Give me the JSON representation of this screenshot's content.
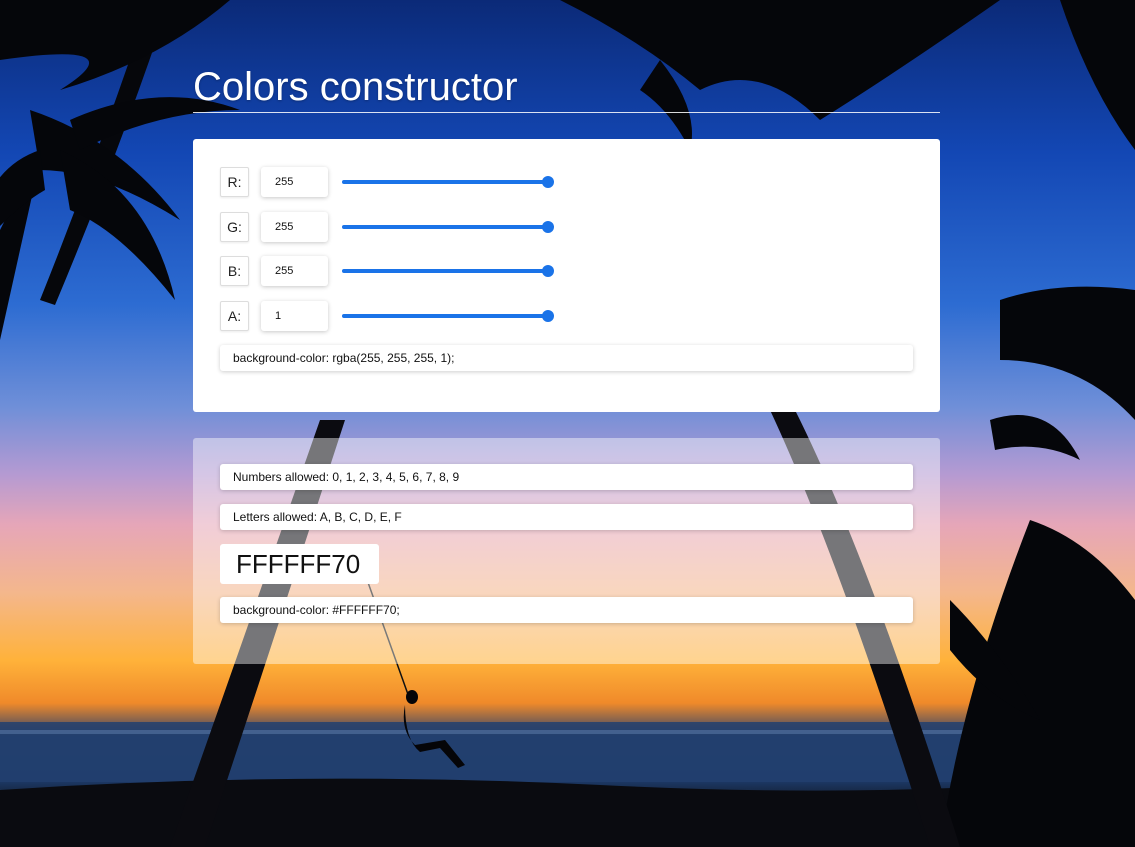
{
  "title": "Colors constructor",
  "rgba_panel": {
    "channels": [
      {
        "label": "R:",
        "value": "255",
        "fraction": 1.0
      },
      {
        "label": "G:",
        "value": "255",
        "fraction": 1.0
      },
      {
        "label": "B:",
        "value": "255",
        "fraction": 1.0
      },
      {
        "label": "A:",
        "value": "1",
        "fraction": 1.0
      }
    ],
    "output": "background-color: rgba(255, 255, 255, 1);"
  },
  "hex_panel": {
    "numbers_hint": "Numbers allowed: 0, 1, 2, 3, 4, 5, 6, 7, 8, 9",
    "letters_hint": "Letters allowed: A, B, C, D, E, F",
    "hex_value": "FFFFFF70",
    "output": "background-color: #FFFFFF70;"
  },
  "colors": {
    "accent": "#1a73e8",
    "panel": "#ffffff"
  }
}
